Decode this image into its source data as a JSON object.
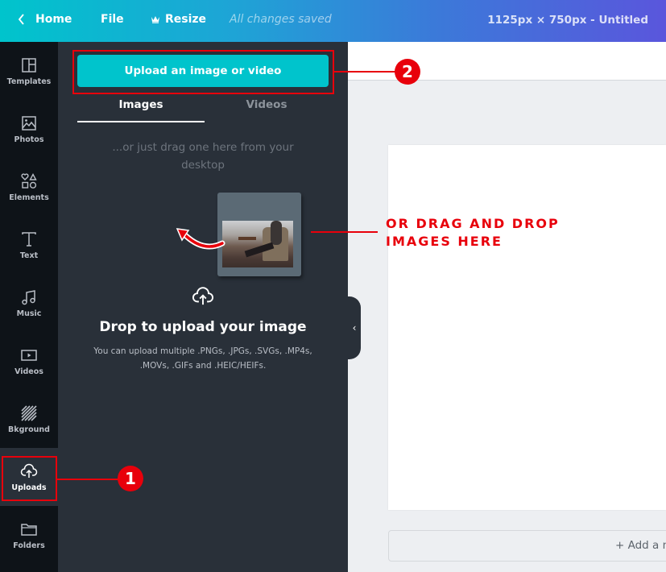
{
  "topbar": {
    "home_label": "Home",
    "file_label": "File",
    "resize_label": "Resize",
    "saved_status": "All changes saved",
    "doc_title": "1125px × 750px - Untitled"
  },
  "sidebar": {
    "items": [
      {
        "label": "Templates",
        "icon": "templates-icon"
      },
      {
        "label": "Photos",
        "icon": "photos-icon"
      },
      {
        "label": "Elements",
        "icon": "elements-icon"
      },
      {
        "label": "Text",
        "icon": "text-icon"
      },
      {
        "label": "Music",
        "icon": "music-icon"
      },
      {
        "label": "Videos",
        "icon": "videos-icon"
      },
      {
        "label": "Bkground",
        "icon": "background-icon"
      },
      {
        "label": "Uploads",
        "icon": "upload-cloud-icon",
        "active": true
      },
      {
        "label": "Folders",
        "icon": "folder-icon"
      }
    ]
  },
  "panel": {
    "upload_button": "Upload an image or video",
    "tabs": [
      {
        "label": "Images",
        "active": true
      },
      {
        "label": "Videos",
        "active": false
      }
    ],
    "drag_hint": "...or just drag one here from your desktop",
    "drop_title": "Drop to upload your image",
    "drop_subtitle": "You can upload multiple .PNGs, .JPGs, .SVGs, .MP4s, .MOVs, .GIFs and .HEIC/HEIFs.",
    "collapse_glyph": "‹"
  },
  "canvas": {
    "add_page_label": "+ Add a new page"
  },
  "annotations": {
    "badge_1": "1",
    "badge_2": "2",
    "callout_line1": "OR DRAG AND DROP",
    "callout_line2": "IMAGES HERE",
    "color": "#e8000b"
  },
  "colors": {
    "accent": "#00c4cc",
    "panel_bg": "#293039",
    "rail_bg": "#0e1318"
  }
}
